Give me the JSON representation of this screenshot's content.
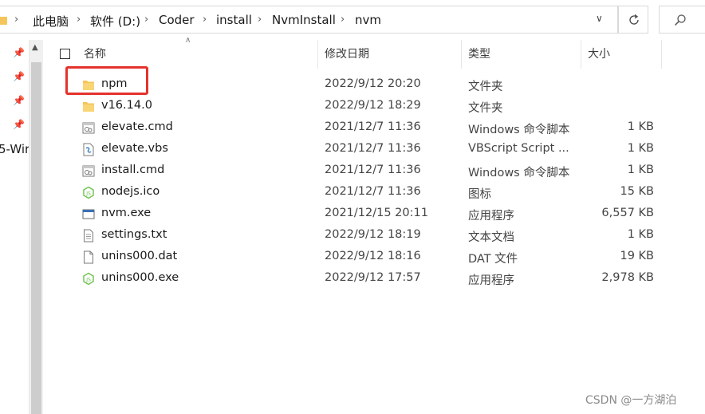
{
  "address_bar": {
    "breadcrumbs": [
      "此电脑",
      "软件 (D:)",
      "Coder",
      "install",
      "NvmInstall",
      "nvm"
    ],
    "separator": "›"
  },
  "nav_pane": {
    "partial_label": "5-Wir"
  },
  "columns": {
    "name": "名称",
    "modified": "修改日期",
    "type": "类型",
    "size": "大小"
  },
  "files": [
    {
      "name": "npm",
      "modified": "2022/9/12 20:20",
      "type": "文件夹",
      "size": "",
      "icon": "folder-icon"
    },
    {
      "name": "v16.14.0",
      "modified": "2022/9/12 18:29",
      "type": "文件夹",
      "size": "",
      "icon": "folder-icon"
    },
    {
      "name": "elevate.cmd",
      "modified": "2021/12/7 11:36",
      "type": "Windows 命令脚本",
      "size": "1 KB",
      "icon": "cmd-file-icon"
    },
    {
      "name": "elevate.vbs",
      "modified": "2021/12/7 11:36",
      "type": "VBScript Script ...",
      "size": "1 KB",
      "icon": "vbs-file-icon"
    },
    {
      "name": "install.cmd",
      "modified": "2021/12/7 11:36",
      "type": "Windows 命令脚本",
      "size": "1 KB",
      "icon": "cmd-file-icon"
    },
    {
      "name": "nodejs.ico",
      "modified": "2021/12/7 11:36",
      "type": "图标",
      "size": "15 KB",
      "icon": "nodejs-icon"
    },
    {
      "name": "nvm.exe",
      "modified": "2021/12/15 20:11",
      "type": "应用程序",
      "size": "6,557 KB",
      "icon": "exe-window-icon"
    },
    {
      "name": "settings.txt",
      "modified": "2022/9/12 18:19",
      "type": "文本文档",
      "size": "1 KB",
      "icon": "text-file-icon"
    },
    {
      "name": "unins000.dat",
      "modified": "2022/9/12 18:16",
      "type": "DAT 文件",
      "size": "19 KB",
      "icon": "blank-file-icon"
    },
    {
      "name": "unins000.exe",
      "modified": "2022/9/12 17:57",
      "type": "应用程序",
      "size": "2,978 KB",
      "icon": "nodejs-icon"
    }
  ],
  "watermark": "CSDN @一方湖泊",
  "colors": {
    "highlight": "#e5322d",
    "folder": "#f4c55b",
    "node_green": "#6cc24a"
  }
}
